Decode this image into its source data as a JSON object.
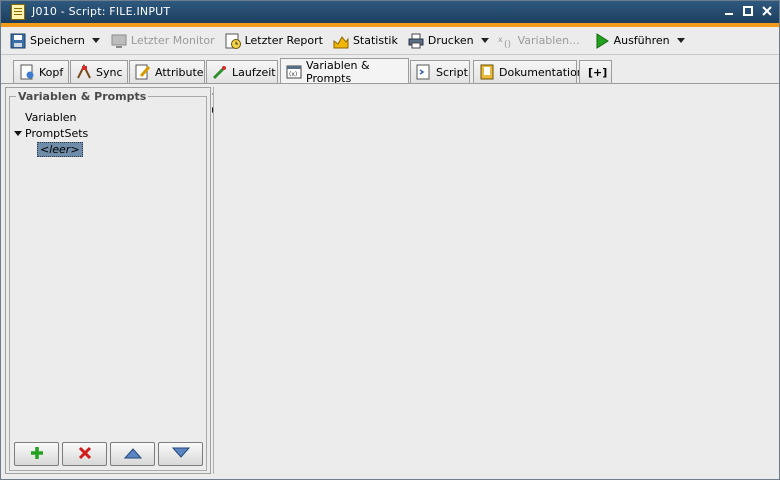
{
  "window": {
    "title": "J010 - Script: FILE.INPUT",
    "icon": "script-document-icon",
    "controls": [
      "minimize-icon",
      "maximize-icon",
      "close-icon"
    ],
    "accent_color": "#f39a19"
  },
  "toolbar": {
    "save_label": "Speichern",
    "last_monitor_label": "Letzter Monitor",
    "last_report_label": "Letzter Report",
    "statistics_label": "Statistik",
    "print_label": "Drucken",
    "variables_label": "Variablen...",
    "execute_label": "Ausführen"
  },
  "tabs": [
    {
      "label": "Kopf",
      "icon": "header-icon"
    },
    {
      "label": "Sync",
      "icon": "sync-icon"
    },
    {
      "label": "Attribute",
      "icon": "attribute-icon"
    },
    {
      "label": "Laufzeit",
      "icon": "runtime-icon"
    },
    {
      "label": "Variablen & Prompts",
      "icon": "variables-icon",
      "active": true
    },
    {
      "label": "Script",
      "icon": "script-icon"
    },
    {
      "label": "Dokumentation",
      "icon": "documentation-icon"
    },
    {
      "label": "[+]",
      "icon": "add-tab-icon"
    }
  ],
  "panel": {
    "title": "Variablen & Prompts",
    "tree": {
      "variables": "Variablen",
      "promptsets": "PromptSets",
      "empty": "<leer>"
    },
    "buttons": [
      "add-icon",
      "delete-icon",
      "move-up-icon",
      "move-down-icon"
    ]
  }
}
